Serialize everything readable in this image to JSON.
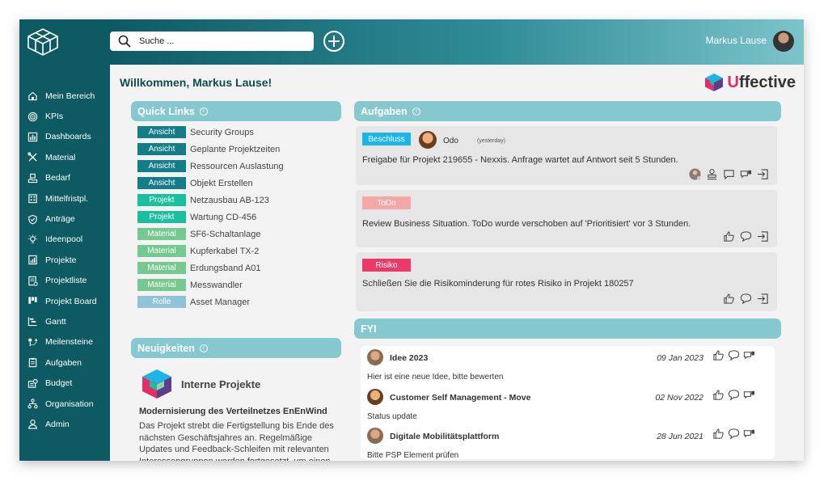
{
  "search": {
    "placeholder": "Suche ..."
  },
  "user": {
    "name": "Markus Lause"
  },
  "colors": {
    "sidebar": "#0d5a63",
    "panel_header": "#86c8cf",
    "ansicht": "#137d88",
    "projekt": "#1bbfa0",
    "material": "#75c990",
    "rolle": "#8fc4d8",
    "beschluss": "#1bb4e4",
    "todo": "#f5a6a6",
    "risiko": "#ec3a68"
  },
  "sidebar": {
    "items": [
      {
        "label": "Mein Bereich",
        "icon": "home-icon"
      },
      {
        "label": "KPIs",
        "icon": "target-icon"
      },
      {
        "label": "Dashboards",
        "icon": "chart-icon"
      },
      {
        "label": "Material",
        "icon": "tools-icon"
      },
      {
        "label": "Bedarf",
        "icon": "hand-box-icon"
      },
      {
        "label": "Mittelfristpl.",
        "icon": "building-icon"
      },
      {
        "label": "Anträge",
        "icon": "shield-icon"
      },
      {
        "label": "Ideenpool",
        "icon": "lightbulb-icon"
      },
      {
        "label": "Projekte",
        "icon": "report-icon"
      },
      {
        "label": "Projektliste",
        "icon": "list-icon"
      },
      {
        "label": "Projekt Board",
        "icon": "board-icon"
      },
      {
        "label": "Gantt",
        "icon": "gantt-icon"
      },
      {
        "label": "Meilensteine",
        "icon": "milestone-icon"
      },
      {
        "label": "Aufgaben",
        "icon": "clipboard-icon"
      },
      {
        "label": "Budget",
        "icon": "budget-icon"
      },
      {
        "label": "Organisation",
        "icon": "org-icon"
      },
      {
        "label": "Admin",
        "icon": "user-icon"
      }
    ]
  },
  "main": {
    "welcome": "Willkommen, Markus Lause!",
    "brand_u": "U",
    "brand_rest": "ffective"
  },
  "quick_links": {
    "title": "Quick Links",
    "items": [
      {
        "tag": "Ansicht",
        "label": "Security Groups"
      },
      {
        "tag": "Ansicht",
        "label": "Geplante Projektzeiten"
      },
      {
        "tag": "Ansicht",
        "label": "Ressourcen Auslastung"
      },
      {
        "tag": "Ansicht",
        "label": "Objekt Erstellen"
      },
      {
        "tag": "Projekt",
        "label": "Netzausbau AB-123"
      },
      {
        "tag": "Projekt",
        "label": "Wartung CD-456"
      },
      {
        "tag": "Material",
        "label": "SF6-Schaltanlage"
      },
      {
        "tag": "Material",
        "label": "Kupferkabel TX-2"
      },
      {
        "tag": "Material",
        "label": "Erdungsband A01"
      },
      {
        "tag": "Material",
        "label": "Messwandler"
      },
      {
        "tag": "Rolle",
        "label": "Asset Manager"
      }
    ]
  },
  "news": {
    "title": "Neuigkeiten",
    "item_title": "Interne Projekte",
    "subtitle": "Modernisierung des Verteilnetzes EnEnWind",
    "body": "Das Projekt strebt die Fertigstellung bis Ende des nächsten Geschäftsjahres an. Regelmäßige Updates und Feedback-Schleifen mit relevanten Interessengruppen werden fortgesetzt, um einen"
  },
  "tasks": {
    "title": "Aufgaben",
    "items": [
      {
        "badge": "Beschluss",
        "who": "Odo",
        "when": "(yesterday)",
        "text": "Freigabe für Projekt 219655 - Nexxis. Anfrage wartet auf Antwort seit 5 Stunden."
      },
      {
        "badge": "ToDo",
        "text": "Review Business Situation. ToDo wurde verschoben auf 'Prioritisiert' vor 3 Stunden."
      },
      {
        "badge": "Risiko",
        "text": "Schließen Sie die Risikominderung für rotes Risiko in Projekt 180257"
      }
    ]
  },
  "fyi": {
    "title": "FYI",
    "items": [
      {
        "title": "Idee 2023",
        "date": "09 Jan 2023",
        "text": "Hier ist eine neue Idee, bitte bewerten"
      },
      {
        "title": "Customer Self Management - Move",
        "date": "02 Nov 2022",
        "text": "Status update"
      },
      {
        "title": "Digitale Mobilitätsplattform",
        "date": "28 Jun 2021",
        "text": "Bitte PSP Element prüfen"
      }
    ]
  }
}
